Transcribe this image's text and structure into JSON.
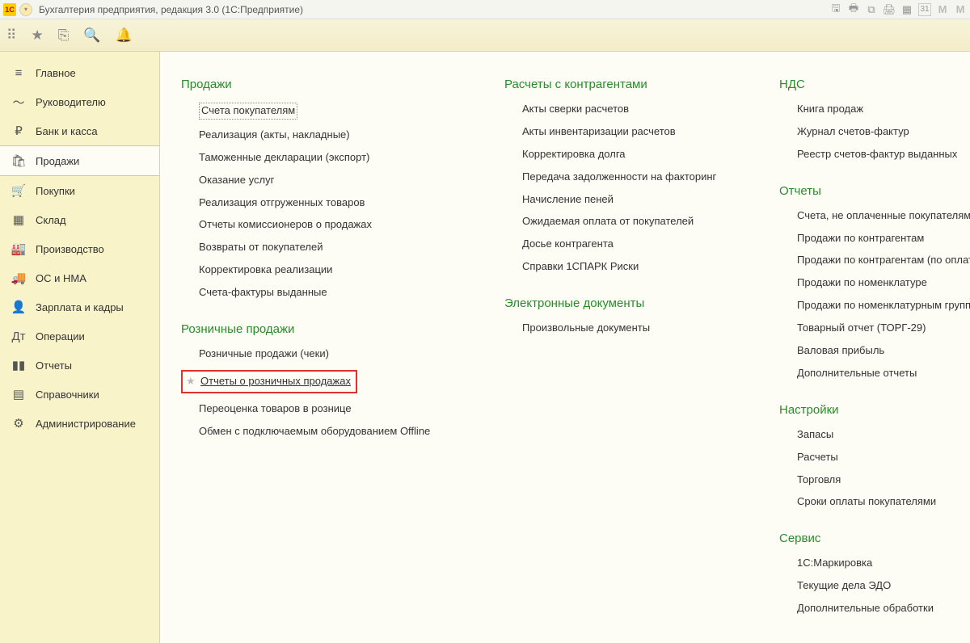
{
  "titlebar": {
    "logo_text": "1C",
    "title": "Бухгалтерия предприятия, редакция 3.0   (1С:Предприятие)",
    "right_m1": "M",
    "right_m2": "M"
  },
  "sidebar": {
    "items": [
      {
        "label": "Главное",
        "icon": "≡"
      },
      {
        "label": "Руководителю",
        "icon": "〜"
      },
      {
        "label": "Банк и касса",
        "icon": "₽"
      },
      {
        "label": "Продажи",
        "icon": "🛍"
      },
      {
        "label": "Покупки",
        "icon": "🛒"
      },
      {
        "label": "Склад",
        "icon": "▦"
      },
      {
        "label": "Производство",
        "icon": "🏭"
      },
      {
        "label": "ОС и НМА",
        "icon": "🚚"
      },
      {
        "label": "Зарплата и кадры",
        "icon": "👤"
      },
      {
        "label": "Операции",
        "icon": "Дт"
      },
      {
        "label": "Отчеты",
        "icon": "▮▮"
      },
      {
        "label": "Справочники",
        "icon": "▤"
      },
      {
        "label": "Администрирование",
        "icon": "⚙"
      }
    ],
    "active_index": 3
  },
  "col1": {
    "sec1": {
      "title": "Продажи",
      "items": [
        "Счета покупателям",
        "Реализация (акты, накладные)",
        "Таможенные декларации (экспорт)",
        "Оказание услуг",
        "Реализация отгруженных товаров",
        "Отчеты комиссионеров о продажах",
        "Возвраты от покупателей",
        "Корректировка реализации",
        "Счета-фактуры выданные"
      ]
    },
    "sec2": {
      "title": "Розничные продажи",
      "items": [
        "Розничные продажи (чеки)",
        "Отчеты о розничных продажах",
        "Переоценка товаров в рознице",
        "Обмен с подключаемым оборудованием Offline"
      ]
    }
  },
  "col2": {
    "sec1": {
      "title": "Расчеты с контрагентами",
      "items": [
        "Акты сверки расчетов",
        "Акты инвентаризации расчетов",
        "Корректировка долга",
        "Передача задолженности на факторинг",
        "Начисление пеней",
        "Ожидаемая оплата от покупателей",
        "Досье контрагента",
        "Справки 1СПАРК Риски"
      ]
    },
    "sec2": {
      "title": "Электронные документы",
      "items": [
        "Произвольные документы"
      ]
    }
  },
  "col3": {
    "sec1": {
      "title": "НДС",
      "items": [
        "Книга продаж",
        "Журнал счетов-фактур",
        "Реестр счетов-фактур выданных"
      ]
    },
    "sec2": {
      "title": "Отчеты",
      "items": [
        "Счета, не оплаченные покупателями",
        "Продажи по контрагентам",
        "Продажи по контрагентам (по оплате)",
        "Продажи по номенклатуре",
        "Продажи по номенклатурным группам",
        "Товарный отчет (ТОРГ-29)",
        "Валовая прибыль",
        "Дополнительные отчеты"
      ]
    },
    "sec3": {
      "title": "Настройки",
      "items": [
        "Запасы",
        "Расчеты",
        "Торговля",
        "Сроки оплаты покупателями"
      ]
    },
    "sec4": {
      "title": "Сервис",
      "items": [
        "1С:Маркировка",
        "Текущие дела ЭДО",
        "Дополнительные обработки"
      ]
    }
  }
}
